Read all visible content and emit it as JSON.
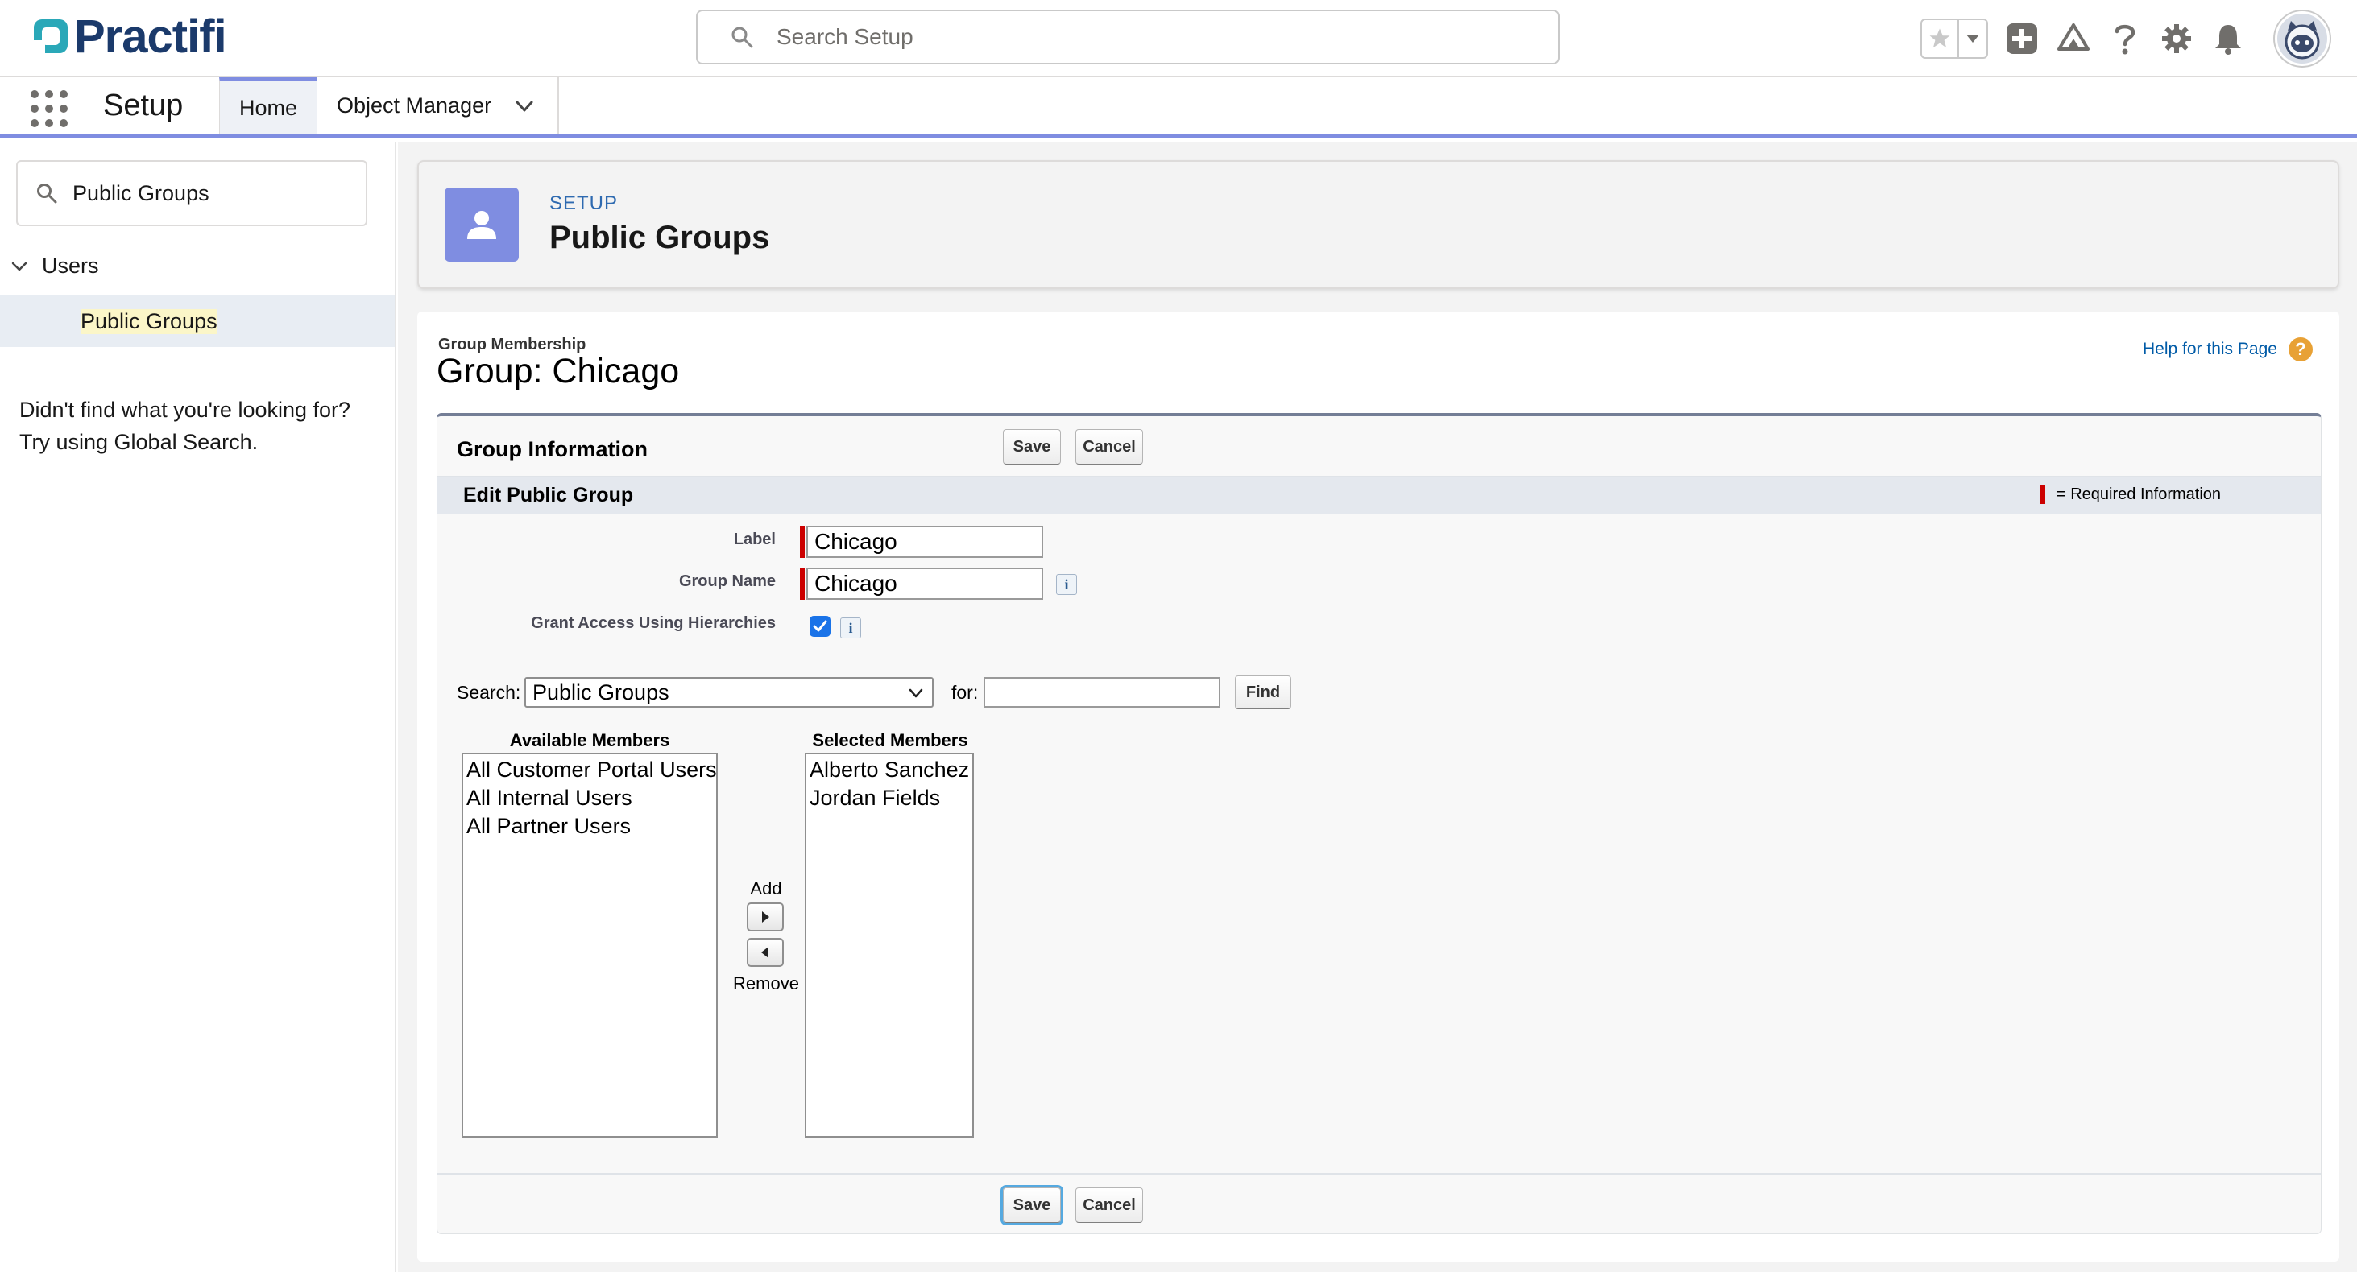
{
  "brand": {
    "name": "Practifi"
  },
  "global_search": {
    "placeholder": "Search Setup"
  },
  "header_icons": [
    "star-icon",
    "chevron-down-icon",
    "add-icon",
    "trailhead-icon",
    "help-icon",
    "gear-icon",
    "bell-icon",
    "avatar"
  ],
  "context_bar": {
    "app_name": "Setup",
    "tabs": [
      {
        "label": "Home",
        "active": true
      },
      {
        "label": "Object Manager",
        "has_menu": true
      }
    ]
  },
  "sidebar": {
    "quick_find_value": "Public Groups",
    "tree": {
      "parent": "Users",
      "child": "Public Groups"
    },
    "not_found_line1": "Didn't find what you're looking for?",
    "not_found_line2": "Try using Global Search."
  },
  "page_header": {
    "eyebrow": "SETUP",
    "title": "Public Groups"
  },
  "content": {
    "breadcrumb": "Group Membership",
    "title": "Group: Chicago",
    "help_link": "Help for this Page",
    "help_icon": "?"
  },
  "form": {
    "block_title": "Group Information",
    "save_label": "Save",
    "cancel_label": "Cancel",
    "section_title": "Edit Public Group",
    "required_legend": "= Required Information",
    "fields": {
      "label_label": "Label",
      "label_value": "Chicago",
      "group_name_label": "Group Name",
      "group_name_value": "Chicago",
      "grant_access_label": "Grant Access Using Hierarchies",
      "grant_access_checked": true,
      "info_glyph": "i"
    },
    "search": {
      "search_label": "Search:",
      "search_selected": "Public Groups",
      "for_label": "for:",
      "for_value": "",
      "find_label": "Find"
    },
    "members": {
      "available_header": "Available Members",
      "available": [
        "All Customer Portal Users",
        "All Internal Users",
        "All Partner Users"
      ],
      "selected_header": "Selected Members",
      "selected": [
        "Alberto Sanchez",
        "Jordan Fields"
      ],
      "add_label": "Add",
      "remove_label": "Remove"
    }
  },
  "colors": {
    "brand_navy": "#1b3a6b",
    "brand_teal": "#2aa8b8",
    "accent_periwinkle": "#7f8de1",
    "required_red": "#cc0000",
    "link_blue": "#015ba7",
    "help_orange": "#e8a135"
  }
}
